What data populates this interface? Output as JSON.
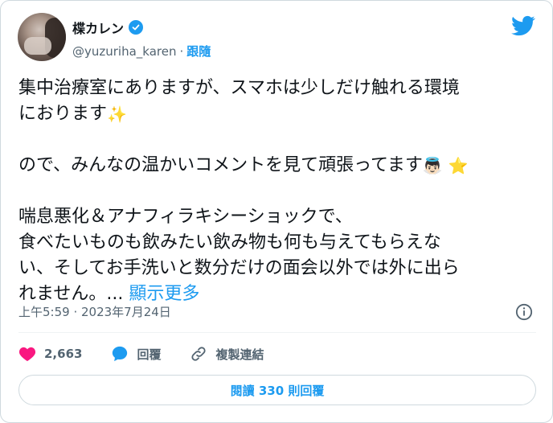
{
  "user": {
    "display_name": "楪カレン",
    "handle": "@yuzuriha_karen",
    "separator": "·",
    "follow_label": "跟隨"
  },
  "tweet": {
    "line1": "集中治療室にありますが、スマホは少しだけ触れる環境",
    "line2": "におります",
    "emoji_sparkles": "✨",
    "line3": "ので、みんなの温かいコメントを見て頑張ってます",
    "emoji_angel": "👼🏻",
    "emoji_star": "⭐",
    "line4": "喘息悪化＆アナフィラキシーショックで、",
    "line5": "食べたいものも飲みたい飲み物も何も与えてもらえな",
    "line6": "い、そしてお手洗いと数分だけの面会以外では外に出ら",
    "line7": "れません。...",
    "show_more": "顯示更多"
  },
  "timestamp": "上午5:59 · 2023年7月24日",
  "actions": {
    "like_count": "2,663",
    "reply_label": "回覆",
    "copy_link_label": "複製連結"
  },
  "read_replies_label": "閱讀 330 則回覆",
  "colors": {
    "accent": "#1d9bf0",
    "like": "#f91880",
    "secondary_text": "#536471",
    "border": "#cfd9de"
  },
  "icons": [
    "verified-badge-icon",
    "twitter-bird-icon",
    "info-icon",
    "heart-icon",
    "reply-bubble-icon",
    "link-icon"
  ]
}
